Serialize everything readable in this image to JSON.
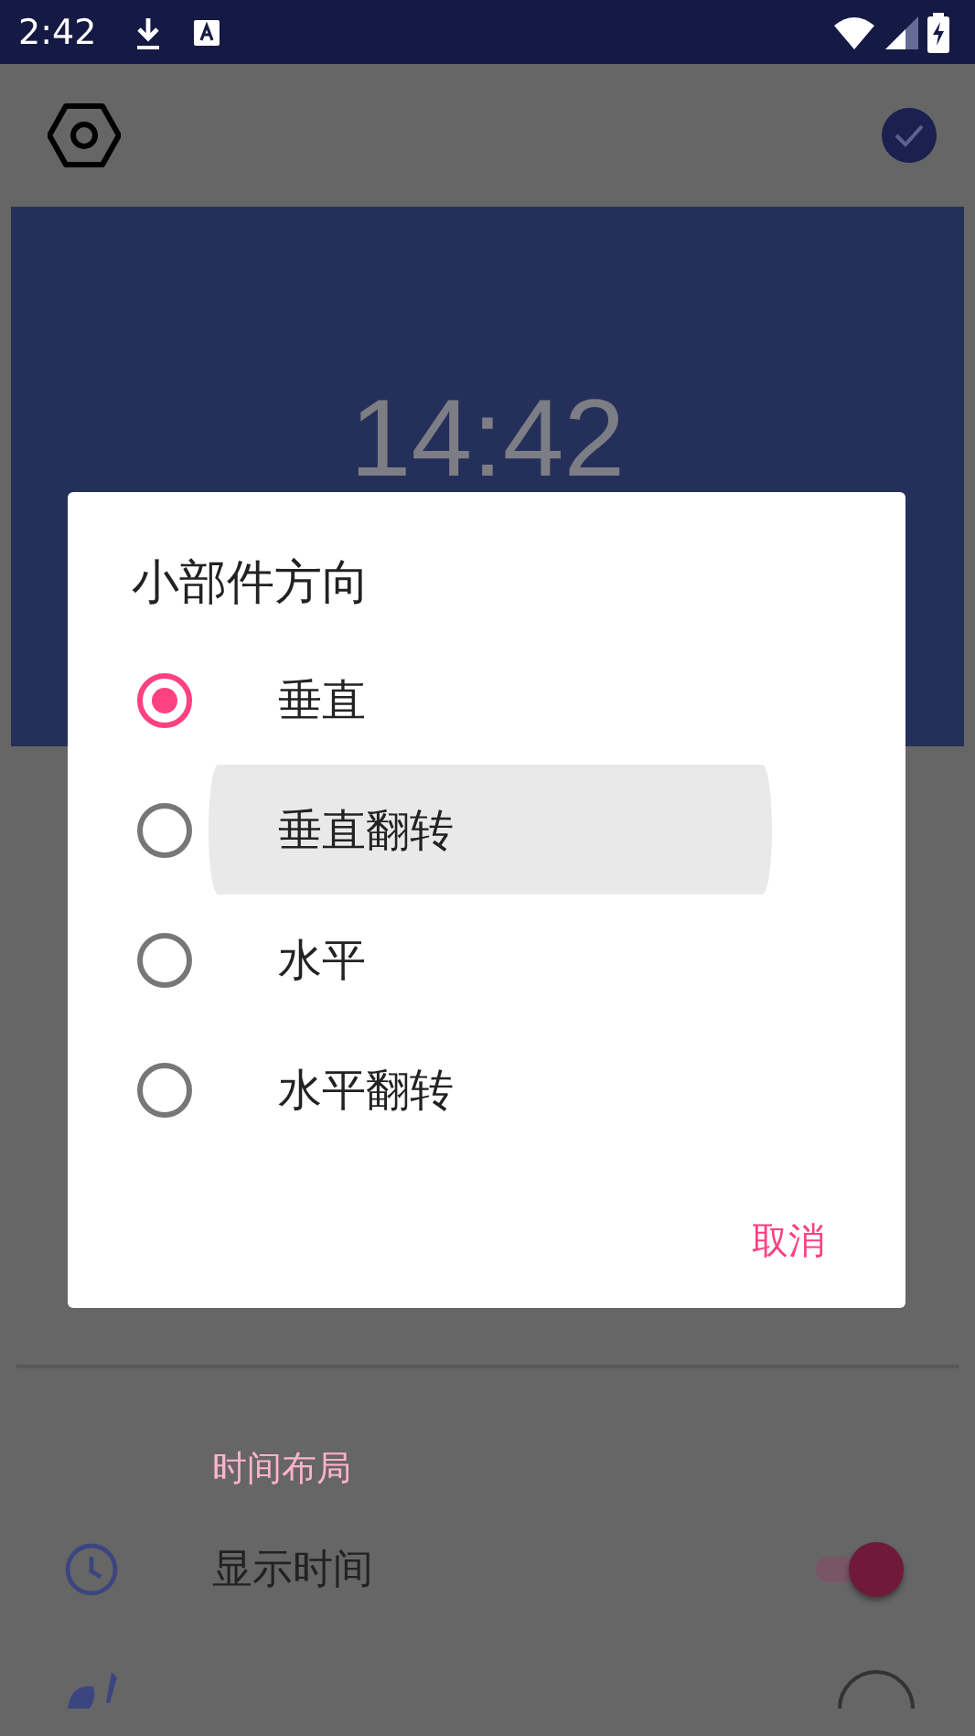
{
  "status_bar": {
    "time": "2:42"
  },
  "preview": {
    "time": "14:42"
  },
  "section": {
    "header": "时间布局"
  },
  "settings": [
    {
      "kind": "switch",
      "label": "显示时间",
      "on": true
    },
    {
      "kind": "color"
    }
  ],
  "dialog": {
    "title": "小部件方向",
    "options": [
      {
        "label": "垂直",
        "selected": true,
        "pressed": false
      },
      {
        "label": "垂直翻转",
        "selected": false,
        "pressed": true
      },
      {
        "label": "水平",
        "selected": false,
        "pressed": false
      },
      {
        "label": "水平翻转",
        "selected": false,
        "pressed": false
      }
    ],
    "buttons": [
      "取消"
    ]
  }
}
